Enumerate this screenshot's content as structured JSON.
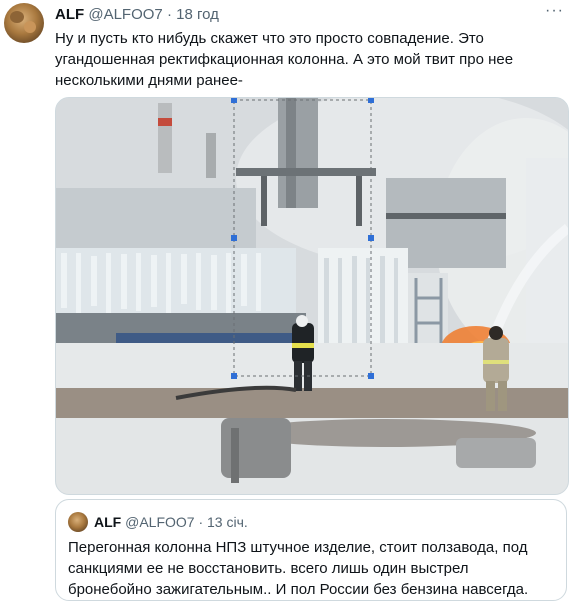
{
  "tweet": {
    "author_name": "ALF",
    "author_handle": "@ALFOO7",
    "separator": "·",
    "time": "18 год",
    "more_label": "···",
    "text_lines": [
      "Ну и пусть кто нибудь скажет что это просто совпадение. Это",
      "угандошенная ректифкационная колонна. А это мой твит про нее",
      "несколькими днями ранее-"
    ]
  },
  "media": {
    "icon": "photo",
    "alt": ""
  },
  "quoted_tweet": {
    "author_name": "ALF",
    "author_handle": "@ALFOO7",
    "separator": "·",
    "time": "13 січ.",
    "text_lines": [
      "Перегонная колонна НПЗ штучное изделие, стоит ползавода, под",
      "санкциями ее не восстановить. всего лишь один выстрел",
      "бронебойно зажигательным.. И пол России без бензина навсегда."
    ]
  },
  "colors": {
    "text": "#0f1419",
    "secondary": "#536471",
    "border": "#cfd9de"
  }
}
